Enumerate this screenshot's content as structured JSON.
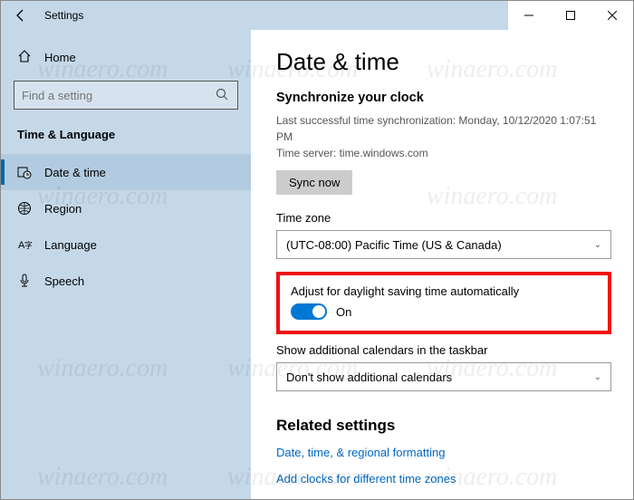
{
  "window": {
    "title": "Settings"
  },
  "sidebar": {
    "home": "Home",
    "search_placeholder": "Find a setting",
    "category": "Time & Language",
    "items": [
      {
        "label": "Date & time"
      },
      {
        "label": "Region"
      },
      {
        "label": "Language"
      },
      {
        "label": "Speech"
      }
    ]
  },
  "main": {
    "title": "Date & time",
    "sync_header": "Synchronize your clock",
    "sync_last": "Last successful time synchronization: Monday, 10/12/2020 1:07:51 PM",
    "sync_server": "Time server: time.windows.com",
    "sync_button": "Sync now",
    "tz_label": "Time zone",
    "tz_value": "(UTC-08:00) Pacific Time (US & Canada)",
    "dst_label": "Adjust for daylight saving time automatically",
    "dst_state": "On",
    "add_cal_label": "Show additional calendars in the taskbar",
    "add_cal_value": "Don't show additional calendars",
    "related_header": "Related settings",
    "related_links": [
      "Date, time, & regional formatting",
      "Add clocks for different time zones"
    ]
  },
  "watermark": "winaero.com"
}
